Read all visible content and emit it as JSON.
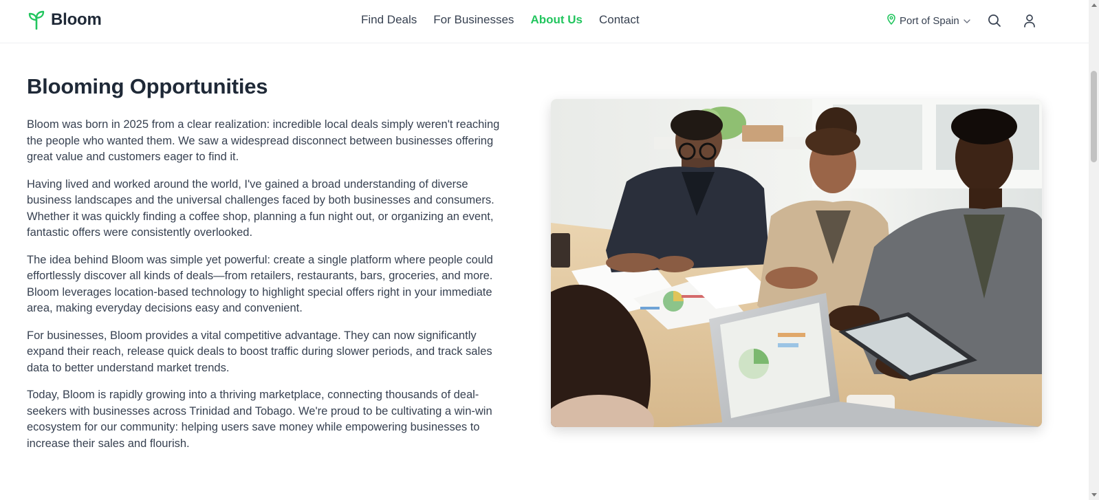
{
  "brand": {
    "name": "Bloom",
    "icon": "sprout-icon",
    "accent": "#22c55e"
  },
  "nav": {
    "items": [
      {
        "label": "Find Deals",
        "active": false
      },
      {
        "label": "For Businesses",
        "active": false
      },
      {
        "label": "About Us",
        "active": true
      },
      {
        "label": "Contact",
        "active": false
      }
    ]
  },
  "header": {
    "location": "Port of Spain",
    "location_icon": "map-pin-icon",
    "search_icon": "search-icon",
    "user_icon": "user-icon"
  },
  "main": {
    "title": "Blooming Opportunities",
    "paragraphs": [
      "Bloom was born in 2025 from a clear realization: incredible local deals simply weren't reaching the people who wanted them. We saw a widespread disconnect between businesses offering great value and customers eager to find it.",
      "Having lived and worked around the world, I've gained a broad understanding of diverse business landscapes and the universal challenges faced by both businesses and consumers. Whether it was quickly finding a coffee shop, planning a fun night out, or organizing an event, fantastic offers were consistently overlooked.",
      "The idea behind Bloom was simple yet powerful: create a single platform where people could effortlessly discover all kinds of deals—from retailers, restaurants, bars, groceries, and more. Bloom leverages location-based technology to highlight special offers right in your immediate area, making everyday decisions easy and convenient.",
      "For businesses, Bloom provides a vital competitive advantage. They can now significantly expand their reach, release quick deals to boost traffic during slower periods, and track sales data to better understand market trends.",
      "Today, Bloom is rapidly growing into a thriving marketplace, connecting thousands of deal-seekers with businesses across Trinidad and Tobago. We're proud to be cultivating a win-win ecosystem for our community: helping users save money while empowering businesses to increase their sales and flourish."
    ],
    "image": "team-meeting-photo"
  }
}
